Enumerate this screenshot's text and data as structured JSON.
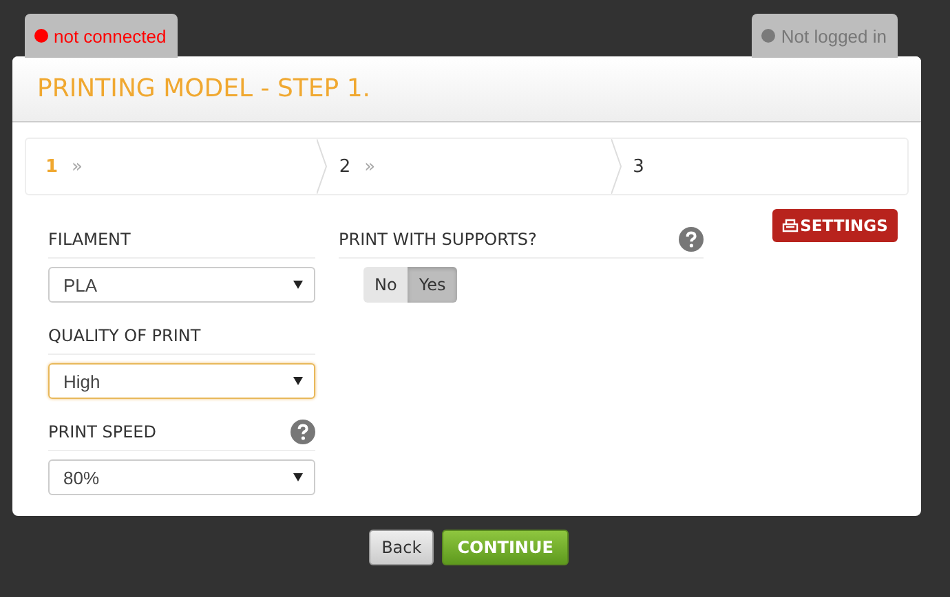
{
  "status": {
    "connection": {
      "label": "not connected",
      "connected": false
    },
    "login": {
      "label": "Not logged in",
      "logged_in": false
    }
  },
  "title": "PRINTING MODEL - STEP 1.",
  "steps": [
    {
      "label": "1",
      "arrow": "»",
      "selected": true
    },
    {
      "label": "2",
      "arrow": "»",
      "selected": false
    },
    {
      "label": "3",
      "selected": false
    }
  ],
  "fields": [
    {
      "label": "FILAMENT",
      "value": "PLA",
      "focused": false,
      "help": false
    },
    {
      "label": "QUALITY OF PRINT",
      "value": "High",
      "focused": true,
      "help": false
    },
    {
      "label": "PRINT SPEED",
      "value": "80%",
      "focused": false,
      "help": true
    }
  ],
  "supports": {
    "label": "PRINT WITH SUPPORTS?",
    "help": true,
    "options": [
      {
        "label": "No",
        "selected": false
      },
      {
        "label": "Yes",
        "selected": true
      }
    ]
  },
  "settings_button": "SETTINGS",
  "buttons": [
    {
      "label": "Back",
      "kind": "secondary"
    },
    {
      "label": "CONTINUE",
      "kind": "primary"
    }
  ]
}
